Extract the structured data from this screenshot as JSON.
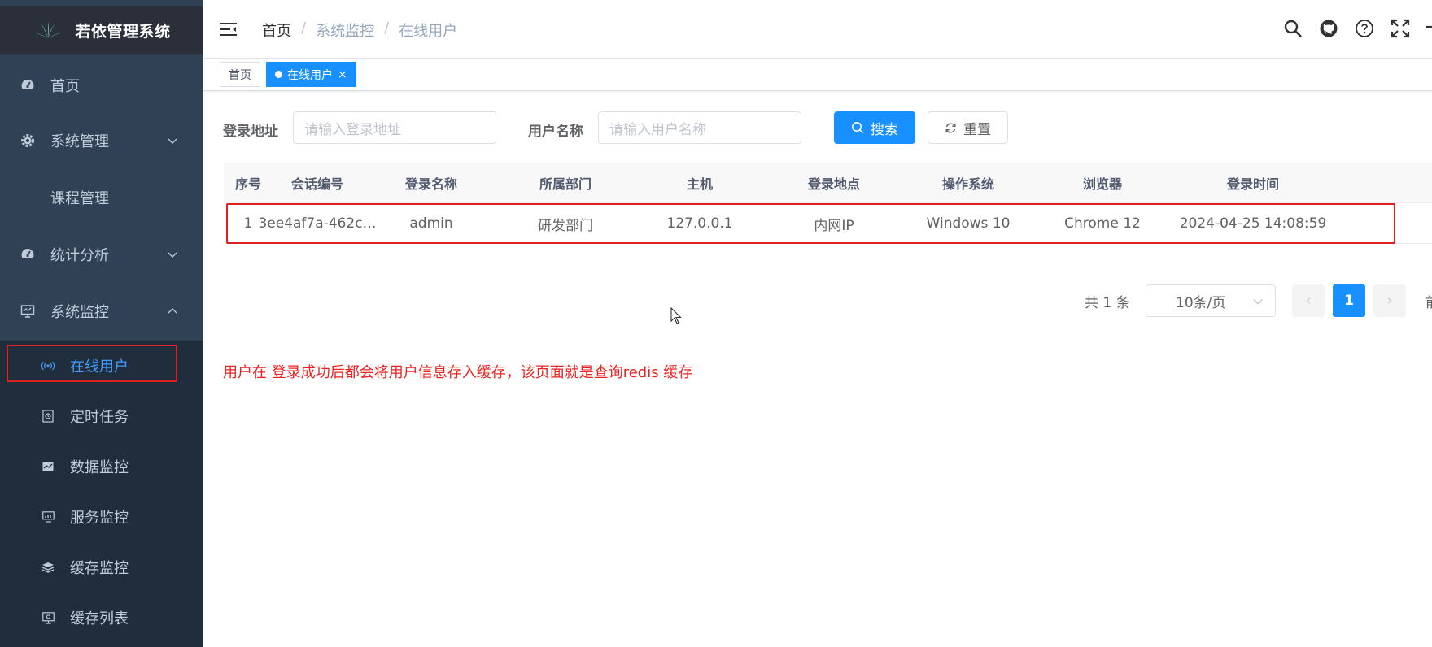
{
  "app": {
    "title": "若依管理系统"
  },
  "sidebar": {
    "items": [
      {
        "label": "首页",
        "icon": "dashboard-icon"
      },
      {
        "label": "系统管理",
        "icon": "gear-icon"
      },
      {
        "label": "课程管理",
        "icon": ""
      },
      {
        "label": "统计分析",
        "icon": "dashboard-icon"
      },
      {
        "label": "系统监控",
        "icon": "monitor-icon"
      }
    ],
    "submenu": [
      {
        "label": "在线用户",
        "icon": "online-icon",
        "active": true
      },
      {
        "label": "定时任务",
        "icon": "job-icon"
      },
      {
        "label": "数据监控",
        "icon": "druid-icon"
      },
      {
        "label": "服务监控",
        "icon": "server-icon"
      },
      {
        "label": "缓存监控",
        "icon": "redis-icon"
      },
      {
        "label": "缓存列表",
        "icon": "redis-list-icon"
      }
    ]
  },
  "navbar": {
    "breadcrumb": [
      "首页",
      "系统监控",
      "在线用户"
    ],
    "separator": "/"
  },
  "tags": {
    "items": [
      {
        "label": "首页"
      },
      {
        "label": "在线用户",
        "close": "×"
      }
    ]
  },
  "search": {
    "ipaddr_label": "登录地址",
    "ipaddr_placeholder": "请输入登录地址",
    "username_label": "用户名称",
    "username_placeholder": "请输入用户名称",
    "search_button": "搜索",
    "reset_button": "重置"
  },
  "table": {
    "columns": [
      "序号",
      "会话编号",
      "登录名称",
      "所属部门",
      "主机",
      "登录地点",
      "操作系统",
      "浏览器",
      "登录时间"
    ],
    "rows": [
      [
        "1",
        "3ee4af7a-462c…",
        "admin",
        "研发部门",
        "127.0.0.1",
        "内网IP",
        "Windows 10",
        "Chrome 12",
        "2024-04-25 14:08:59"
      ]
    ]
  },
  "pagination": {
    "total_text": "共 1 条",
    "page_size": "10条/页",
    "prev": "‹",
    "current": "1",
    "next": "›",
    "jump_partial": "前"
  },
  "annotation": {
    "text": "用户在 登录成功后都会将用户信息存入缓存，该页面就是查询redis 缓存",
    "color": "#f02020"
  },
  "colors": {
    "sidebar_bg": "#304156",
    "submenu_bg": "#1f2d3d",
    "primary": "#1890ff",
    "active_menu_text": "#409eff",
    "annotation_red": "#e02020"
  }
}
